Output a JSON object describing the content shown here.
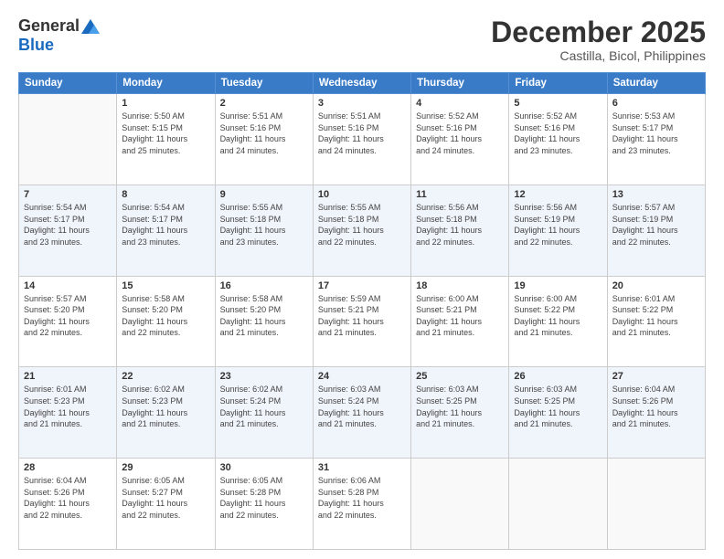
{
  "logo": {
    "general": "General",
    "blue": "Blue"
  },
  "title": "December 2025",
  "subtitle": "Castilla, Bicol, Philippines",
  "headers": [
    "Sunday",
    "Monday",
    "Tuesday",
    "Wednesday",
    "Thursday",
    "Friday",
    "Saturday"
  ],
  "weeks": [
    [
      {
        "day": "",
        "info": ""
      },
      {
        "day": "1",
        "info": "Sunrise: 5:50 AM\nSunset: 5:15 PM\nDaylight: 11 hours\nand 25 minutes."
      },
      {
        "day": "2",
        "info": "Sunrise: 5:51 AM\nSunset: 5:16 PM\nDaylight: 11 hours\nand 24 minutes."
      },
      {
        "day": "3",
        "info": "Sunrise: 5:51 AM\nSunset: 5:16 PM\nDaylight: 11 hours\nand 24 minutes."
      },
      {
        "day": "4",
        "info": "Sunrise: 5:52 AM\nSunset: 5:16 PM\nDaylight: 11 hours\nand 24 minutes."
      },
      {
        "day": "5",
        "info": "Sunrise: 5:52 AM\nSunset: 5:16 PM\nDaylight: 11 hours\nand 23 minutes."
      },
      {
        "day": "6",
        "info": "Sunrise: 5:53 AM\nSunset: 5:17 PM\nDaylight: 11 hours\nand 23 minutes."
      }
    ],
    [
      {
        "day": "7",
        "info": "Sunrise: 5:54 AM\nSunset: 5:17 PM\nDaylight: 11 hours\nand 23 minutes."
      },
      {
        "day": "8",
        "info": "Sunrise: 5:54 AM\nSunset: 5:17 PM\nDaylight: 11 hours\nand 23 minutes."
      },
      {
        "day": "9",
        "info": "Sunrise: 5:55 AM\nSunset: 5:18 PM\nDaylight: 11 hours\nand 23 minutes."
      },
      {
        "day": "10",
        "info": "Sunrise: 5:55 AM\nSunset: 5:18 PM\nDaylight: 11 hours\nand 22 minutes."
      },
      {
        "day": "11",
        "info": "Sunrise: 5:56 AM\nSunset: 5:18 PM\nDaylight: 11 hours\nand 22 minutes."
      },
      {
        "day": "12",
        "info": "Sunrise: 5:56 AM\nSunset: 5:19 PM\nDaylight: 11 hours\nand 22 minutes."
      },
      {
        "day": "13",
        "info": "Sunrise: 5:57 AM\nSunset: 5:19 PM\nDaylight: 11 hours\nand 22 minutes."
      }
    ],
    [
      {
        "day": "14",
        "info": "Sunrise: 5:57 AM\nSunset: 5:20 PM\nDaylight: 11 hours\nand 22 minutes."
      },
      {
        "day": "15",
        "info": "Sunrise: 5:58 AM\nSunset: 5:20 PM\nDaylight: 11 hours\nand 22 minutes."
      },
      {
        "day": "16",
        "info": "Sunrise: 5:58 AM\nSunset: 5:20 PM\nDaylight: 11 hours\nand 21 minutes."
      },
      {
        "day": "17",
        "info": "Sunrise: 5:59 AM\nSunset: 5:21 PM\nDaylight: 11 hours\nand 21 minutes."
      },
      {
        "day": "18",
        "info": "Sunrise: 6:00 AM\nSunset: 5:21 PM\nDaylight: 11 hours\nand 21 minutes."
      },
      {
        "day": "19",
        "info": "Sunrise: 6:00 AM\nSunset: 5:22 PM\nDaylight: 11 hours\nand 21 minutes."
      },
      {
        "day": "20",
        "info": "Sunrise: 6:01 AM\nSunset: 5:22 PM\nDaylight: 11 hours\nand 21 minutes."
      }
    ],
    [
      {
        "day": "21",
        "info": "Sunrise: 6:01 AM\nSunset: 5:23 PM\nDaylight: 11 hours\nand 21 minutes."
      },
      {
        "day": "22",
        "info": "Sunrise: 6:02 AM\nSunset: 5:23 PM\nDaylight: 11 hours\nand 21 minutes."
      },
      {
        "day": "23",
        "info": "Sunrise: 6:02 AM\nSunset: 5:24 PM\nDaylight: 11 hours\nand 21 minutes."
      },
      {
        "day": "24",
        "info": "Sunrise: 6:03 AM\nSunset: 5:24 PM\nDaylight: 11 hours\nand 21 minutes."
      },
      {
        "day": "25",
        "info": "Sunrise: 6:03 AM\nSunset: 5:25 PM\nDaylight: 11 hours\nand 21 minutes."
      },
      {
        "day": "26",
        "info": "Sunrise: 6:03 AM\nSunset: 5:25 PM\nDaylight: 11 hours\nand 21 minutes."
      },
      {
        "day": "27",
        "info": "Sunrise: 6:04 AM\nSunset: 5:26 PM\nDaylight: 11 hours\nand 21 minutes."
      }
    ],
    [
      {
        "day": "28",
        "info": "Sunrise: 6:04 AM\nSunset: 5:26 PM\nDaylight: 11 hours\nand 22 minutes."
      },
      {
        "day": "29",
        "info": "Sunrise: 6:05 AM\nSunset: 5:27 PM\nDaylight: 11 hours\nand 22 minutes."
      },
      {
        "day": "30",
        "info": "Sunrise: 6:05 AM\nSunset: 5:28 PM\nDaylight: 11 hours\nand 22 minutes."
      },
      {
        "day": "31",
        "info": "Sunrise: 6:06 AM\nSunset: 5:28 PM\nDaylight: 11 hours\nand 22 minutes."
      },
      {
        "day": "",
        "info": ""
      },
      {
        "day": "",
        "info": ""
      },
      {
        "day": "",
        "info": ""
      }
    ]
  ]
}
